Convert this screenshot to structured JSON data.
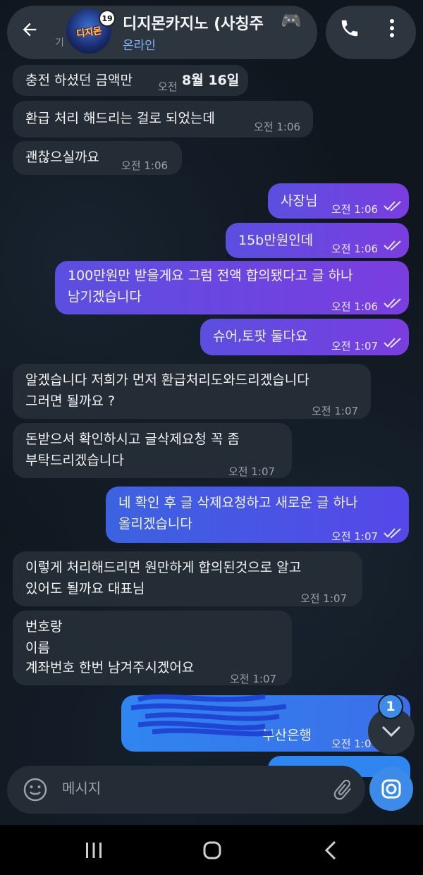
{
  "header": {
    "title": "디지몬카지노 (사칭주",
    "status": "온라인",
    "avatar_text": "디지몬",
    "age_badge": "19",
    "ghost_text": "기",
    "title_emoji": "🎮"
  },
  "messages": [
    {
      "side": "in",
      "text": [
        "충전 하셨던 금액만"
      ],
      "time": "오전",
      "date_overlay": "8월 16일"
    },
    {
      "side": "in",
      "text": [
        "환급 처리 해드리는 걸로 되었는데"
      ],
      "time": "오전 1:06"
    },
    {
      "side": "in",
      "text": [
        "괜찮으실까요"
      ],
      "time": "오전 1:06"
    },
    {
      "side": "out",
      "text": [
        "사장님"
      ],
      "time": "오전 1:06",
      "read": true
    },
    {
      "side": "out",
      "text": [
        "15b만원인데"
      ],
      "time": "오전 1:06",
      "read": true
    },
    {
      "side": "out",
      "text": [
        "100만원만 받을게요 그럼 전액 합의됐다고 글 하나",
        "남기겠습니다"
      ],
      "time": "오전 1:06",
      "read": true
    },
    {
      "side": "out",
      "text": [
        "슈어,토팟 둘다요"
      ],
      "time": "오전 1:07",
      "read": true
    },
    {
      "side": "in",
      "text": [
        "알겠습니다 저희가 먼저 환급처리도와드리겠습니다",
        "그러면 될까요 ?"
      ],
      "time": "오전 1:07"
    },
    {
      "side": "in",
      "text": [
        "돈받으셔 확인하시고 글삭제요청 꼭 좀",
        "부탁드리겠습니다"
      ],
      "time": "오전 1:07"
    },
    {
      "side": "out",
      "text": [
        "네 확인 후 글 삭제요청하고 새로운 글 하나",
        "올리겠습니다"
      ],
      "time": "오전 1:07",
      "read": true
    },
    {
      "side": "in",
      "text": [
        "이렇게 처리해드리면 원만하게 합의된것으로 알고",
        "있어도 될까요  대표님"
      ],
      "time": "오전 1:07"
    },
    {
      "side": "in",
      "text": [
        "번호랑",
        "이름",
        "계좌번호 한번 남겨주시겠어요"
      ],
      "time": "오전 1:07"
    },
    {
      "side": "out",
      "text": [
        "부산은행"
      ],
      "time": "오전 1:0",
      "read": true,
      "redacted": true
    }
  ],
  "scroll_fab": {
    "unread_count": "1"
  },
  "composer": {
    "placeholder": "메시지"
  },
  "colors": {
    "incoming_bubble": "#242c36",
    "outgoing_purple": "#6a45e0",
    "outgoing_blue": "#4a55e6",
    "accent": "#3d8be8",
    "status": "#7db7ff"
  }
}
